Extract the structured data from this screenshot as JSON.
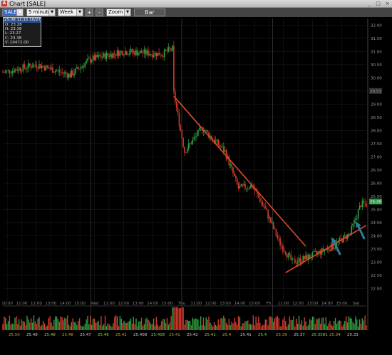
{
  "window": {
    "title": "Chart [SALE]",
    "app_icon": "chart-app-icon"
  },
  "toolbar": {
    "symbol": "SALE",
    "interval": "5 minutes",
    "range": "Week",
    "plus_label": "+",
    "minus_label": "-",
    "zoom_label": "Zoom",
    "bar_label": "Bar"
  },
  "ohlc": {
    "header": "25.08 11:15 10/27",
    "open": "O: 23.28",
    "high": "H: 23.38",
    "low": "L: 23.27",
    "close": "C: 23.38",
    "volume": "V: 10472.00"
  },
  "colors": {
    "up": "#2ea043",
    "down": "#d43c2c",
    "trendline": "#e04a28",
    "arrow": "#2e7d96",
    "grid": "#1a1a1a",
    "axis_text": "#9a9a9a"
  },
  "chart_data": {
    "type": "candlestick",
    "ylim": [
      21.5,
      32.25
    ],
    "y_ticks": [
      "32.00",
      "31.50",
      "31.00",
      "30.50",
      "30.00",
      "29.50",
      "29.00",
      "28.50",
      "28.00",
      "27.50",
      "27.00",
      "26.50",
      "26.00",
      "25.50",
      "25.00",
      "24.50",
      "24.00",
      "23.50",
      "23.00",
      "22.50",
      "22.00"
    ],
    "price_labels": [
      {
        "value": 29.5,
        "text": "29.53"
      },
      {
        "value": 25.3,
        "text": "25.35"
      }
    ],
    "x_ticks": [
      "10:00",
      "11:00",
      "12:00",
      "13:00",
      "14:00",
      "15:00",
      "Wed",
      "11:00",
      "12:00",
      "13:00",
      "14:00",
      "15:00",
      "Thu",
      "11:00",
      "12:00",
      "13:00",
      "14:00",
      "15:00",
      "Fri",
      "11:00",
      "12:00",
      "13:00",
      "14:00",
      "15:00",
      "Sat"
    ],
    "price_strip": [
      "25.50",
      "25.48",
      "25.48",
      "25.48",
      "25.47",
      "25.46",
      "25.42",
      "25.408",
      "25.408",
      "25.41",
      "25.42",
      "25.41",
      "25.4",
      "25.41",
      "25.4",
      "25.39",
      "25.37",
      "25.3581",
      "25.34",
      "25.33"
    ],
    "session_closes": [
      30.3,
      31.1,
      30.9,
      29.3,
      29.8
    ],
    "key_points": [
      {
        "t": 0,
        "price": 30.2
      },
      {
        "t": 25,
        "price": 30.5
      },
      {
        "t": 50,
        "price": 30.1
      },
      {
        "t": 65,
        "price": 30.7
      },
      {
        "t": 90,
        "price": 31.0
      },
      {
        "t": 118,
        "price": 30.9
      },
      {
        "t": 126,
        "price": 31.1
      },
      {
        "t": 127,
        "price": 29.4
      },
      {
        "t": 135,
        "price": 27.2
      },
      {
        "t": 148,
        "price": 28.1
      },
      {
        "t": 165,
        "price": 27.2
      },
      {
        "t": 175,
        "price": 25.8
      },
      {
        "t": 185,
        "price": 25.9
      },
      {
        "t": 195,
        "price": 25.0
      },
      {
        "t": 205,
        "price": 23.8
      },
      {
        "t": 215,
        "price": 23.0
      },
      {
        "t": 222,
        "price": 23.1
      },
      {
        "t": 232,
        "price": 23.3
      },
      {
        "t": 245,
        "price": 23.6
      },
      {
        "t": 258,
        "price": 24.1
      },
      {
        "t": 266,
        "price": 25.2
      }
    ],
    "trendlines": [
      {
        "name": "resistance",
        "from": {
          "t": 127,
          "price": 29.3
        },
        "to": {
          "t": 225,
          "price": 23.6
        }
      },
      {
        "name": "support",
        "from": {
          "t": 210,
          "price": 22.6
        },
        "to": {
          "t": 270,
          "price": 24.4
        }
      }
    ],
    "annotations": [
      {
        "type": "arrow",
        "at": {
          "t": 245,
          "price": 23.9
        }
      },
      {
        "type": "arrow",
        "at": {
          "t": 263,
          "price": 24.5
        }
      }
    ],
    "grid": true,
    "volume_panel": true
  }
}
